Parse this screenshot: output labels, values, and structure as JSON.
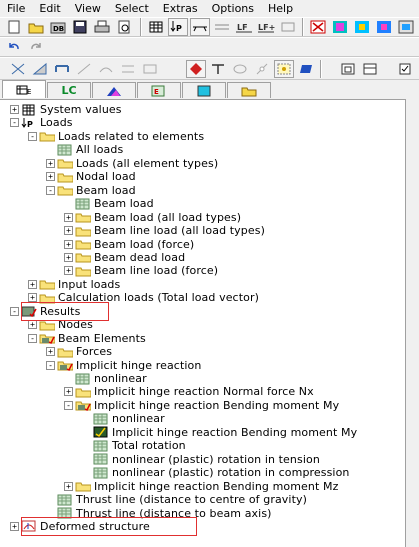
{
  "menu": [
    "File",
    "Edit",
    "View",
    "Select",
    "Extras",
    "Options",
    "Help"
  ],
  "tabs": [
    {
      "label": "",
      "icon": "structure-icon"
    },
    {
      "label": "LC",
      "icon": ""
    },
    {
      "label": "",
      "icon": "material-icon"
    },
    {
      "label": "",
      "icon": "results-icon"
    },
    {
      "label": "",
      "icon": "display-icon"
    },
    {
      "label": "",
      "icon": "folder-icon"
    }
  ],
  "tree": [
    {
      "label": "System values",
      "level": 0,
      "exp": "+",
      "icon": "table-icon"
    },
    {
      "label": "Loads",
      "level": 0,
      "exp": "-",
      "icon": "loads-icon"
    },
    {
      "label": "Loads related to elements",
      "level": 1,
      "exp": "-",
      "icon": "folder-icon"
    },
    {
      "label": "All loads",
      "level": 2,
      "exp": "",
      "icon": "grid-icon"
    },
    {
      "label": "Loads (all element types)",
      "level": 2,
      "exp": "+",
      "icon": "folder-icon"
    },
    {
      "label": "Nodal load",
      "level": 2,
      "exp": "+",
      "icon": "folder-icon"
    },
    {
      "label": "Beam load",
      "level": 2,
      "exp": "-",
      "icon": "folder-icon"
    },
    {
      "label": "Beam load",
      "level": 3,
      "exp": "",
      "icon": "grid-icon"
    },
    {
      "label": "Beam load (all load types)",
      "level": 3,
      "exp": "+",
      "icon": "folder-icon"
    },
    {
      "label": "Beam line load (all load types)",
      "level": 3,
      "exp": "+",
      "icon": "folder-icon"
    },
    {
      "label": "Beam load (force)",
      "level": 3,
      "exp": "+",
      "icon": "folder-icon"
    },
    {
      "label": "Beam dead load",
      "level": 3,
      "exp": "+",
      "icon": "folder-icon"
    },
    {
      "label": "Beam line load (force)",
      "level": 3,
      "exp": "+",
      "icon": "folder-icon"
    },
    {
      "label": "Input loads",
      "level": 1,
      "exp": "+",
      "icon": "folder-icon"
    },
    {
      "label": "Calculation loads (Total load vector)",
      "level": 1,
      "exp": "+",
      "icon": "folder-icon"
    },
    {
      "label": "Results",
      "level": 0,
      "exp": "-",
      "icon": "results-icon"
    },
    {
      "label": "Nodes",
      "level": 1,
      "exp": "+",
      "icon": "folder-icon"
    },
    {
      "label": "Beam Elements",
      "level": 1,
      "exp": "-",
      "icon": "results-folder-icon"
    },
    {
      "label": "Forces",
      "level": 2,
      "exp": "+",
      "icon": "folder-icon"
    },
    {
      "label": "Implicit hinge reaction",
      "level": 2,
      "exp": "-",
      "icon": "results-folder-icon"
    },
    {
      "label": "nonlinear",
      "level": 3,
      "exp": "",
      "icon": "grid-icon"
    },
    {
      "label": "Implicit hinge reaction Normal force Nx",
      "level": 3,
      "exp": "+",
      "icon": "folder-icon"
    },
    {
      "label": "Implicit hinge reaction Bending moment My",
      "level": 3,
      "exp": "-",
      "icon": "results-folder-icon"
    },
    {
      "label": "nonlinear",
      "level": 4,
      "exp": "",
      "icon": "grid-icon"
    },
    {
      "label": "Implicit hinge reaction Bending moment My",
      "level": 4,
      "exp": "",
      "icon": "result-table-icon"
    },
    {
      "label": "Total rotation",
      "level": 4,
      "exp": "",
      "icon": "grid-icon"
    },
    {
      "label": "nonlinear (plastic) rotation in tension",
      "level": 4,
      "exp": "",
      "icon": "grid-icon"
    },
    {
      "label": "nonlinear (plastic) rotation in compression",
      "level": 4,
      "exp": "",
      "icon": "grid-icon"
    },
    {
      "label": "Implicit hinge reaction Bending moment Mz",
      "level": 3,
      "exp": "+",
      "icon": "folder-icon"
    },
    {
      "label": "Thrust line (distance to centre of gravity)",
      "level": 2,
      "exp": "",
      "icon": "grid-icon"
    },
    {
      "label": "Thrust line (distance to beam axis)",
      "level": 2,
      "exp": "",
      "icon": "grid-icon"
    },
    {
      "label": "Deformed structure",
      "level": 0,
      "exp": "+",
      "icon": "deformed-icon"
    }
  ],
  "colors": {
    "highlight": "#e03030",
    "tab_lc": "#0a8a2a",
    "toolbar_bg": "#f0f0f0"
  }
}
